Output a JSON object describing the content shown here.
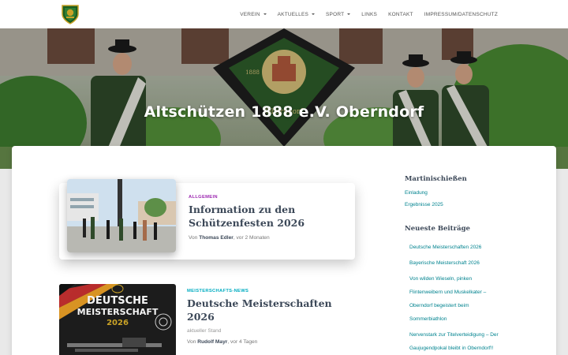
{
  "nav": {
    "items": [
      {
        "label": "VEREIN",
        "caret": true
      },
      {
        "label": "AKTUELLES",
        "caret": true
      },
      {
        "label": "SPORT",
        "caret": true
      },
      {
        "label": "LINKS",
        "caret": false
      },
      {
        "label": "KONTAKT",
        "caret": false
      },
      {
        "label": "IMPRESSUM/DATENSCHUTZ",
        "caret": false
      }
    ]
  },
  "hero": {
    "title": "Altschützen 1888 e.V. Oberndorf",
    "banner_text": "Oberndorf",
    "banner_year": "1888"
  },
  "posts": [
    {
      "category": "ALLGEMEIN",
      "title_line1": "Information zu den",
      "title_line2": "Schützenfesten 2026",
      "by": "Von",
      "author": "Thomas Edler",
      "time": ", vor 2 Monaten"
    },
    {
      "category": "MEISTERSCHAFTS-NEWS",
      "title": "Deutsche Meisterschaften 2026",
      "excerpt": "aktueller Stand",
      "by": "Von",
      "author": "Rudolf Mayr",
      "time": ", vor 4 Tagen",
      "thumb_line1": "DEUTSCHE",
      "thumb_line2": "MEISTERSCHAFT",
      "thumb_line3": "2026"
    }
  ],
  "sidebar": {
    "widget1_title": "Martinischießen",
    "widget1_links": [
      "Einladung",
      "Ergebnisse 2025"
    ],
    "widget2_title": "Neueste Beiträge",
    "recent": [
      "Deutsche Meisterschaften 2026",
      "Bayerische Meisterschaft 2026",
      "Von wilden Wieseln, pinken",
      "Flintenweibern und Muskelkater –",
      "Oberndorf begeistert beim",
      "Sommerbiathlon",
      "Nervenstark zur Titelverteidigung – Der",
      "Gaujugendpokal bleibt in Oberndorf!!"
    ]
  },
  "colors": {
    "accent_purple": "#9c27b0",
    "accent_teal": "#00acc1",
    "link": "#00838f",
    "title": "#3c4858"
  }
}
